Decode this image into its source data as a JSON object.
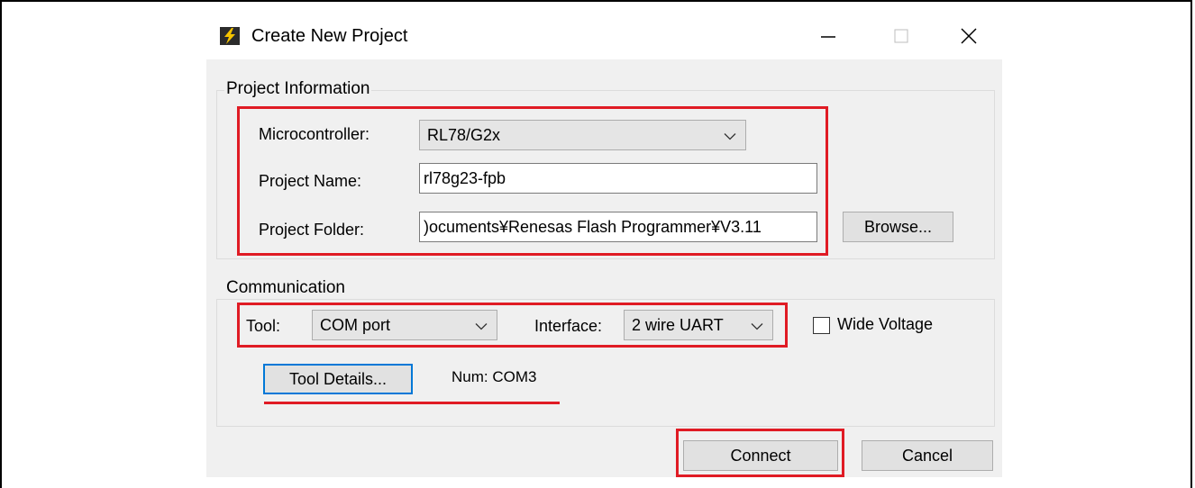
{
  "window": {
    "title": "Create New Project"
  },
  "project_info": {
    "group_title": "Project Information",
    "microcontroller_label": "Microcontroller:",
    "microcontroller_value": "RL78/G2x",
    "project_name_label": "Project Name:",
    "project_name_value": "rl78g23-fpb",
    "project_folder_label": "Project Folder:",
    "project_folder_value": ")ocuments¥Renesas Flash Programmer¥V3.11",
    "browse_label": "Browse..."
  },
  "communication": {
    "group_title": "Communication",
    "tool_label": "Tool:",
    "tool_value": "COM port",
    "interface_label": "Interface:",
    "interface_value": "2 wire UART",
    "wide_voltage_label": "Wide Voltage",
    "wide_voltage_checked": false,
    "tool_details_label": "Tool Details...",
    "num_text": "Num: COM3"
  },
  "footer": {
    "connect_label": "Connect",
    "cancel_label": "Cancel"
  },
  "colors": {
    "highlight": "#e01b24",
    "focus": "#0078d7",
    "window_bg": "#f0f0f0"
  }
}
